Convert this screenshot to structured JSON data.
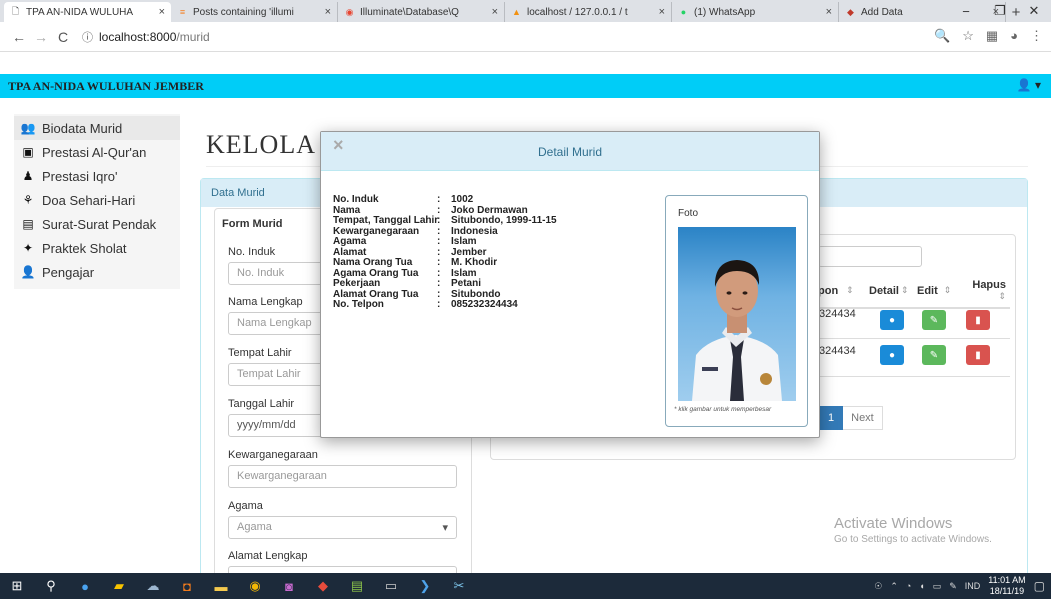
{
  "browser": {
    "tabs": [
      {
        "title": "TPA AN-NIDA WULUHA",
        "icon": "page-icon",
        "active": true
      },
      {
        "title": "Posts containing 'illumi",
        "icon": "stack-icon"
      },
      {
        "title": "Illuminate\\Database\\Q",
        "icon": "laravel-icon"
      },
      {
        "title": "localhost / 127.0.0.1 / t",
        "icon": "phpmyadmin-icon"
      },
      {
        "title": "(1) WhatsApp",
        "icon": "whatsapp-icon"
      },
      {
        "title": "Add Data",
        "icon": "graduation-cap-icon"
      }
    ],
    "url_host": "localhost:8000",
    "url_path": "/murid"
  },
  "app": {
    "brand": "TPA AN-NIDA WULUHAN JEMBER",
    "user_icon": "user-icon",
    "sidebar": [
      {
        "label": "Biodata Murid",
        "icon": "users-icon",
        "active": true
      },
      {
        "label": "Prestasi Al-Qur'an",
        "icon": "book-icon"
      },
      {
        "label": "Prestasi Iqro'",
        "icon": "reader-icon"
      },
      {
        "label": "Doa Sehari-Hari",
        "icon": "pray-icon"
      },
      {
        "label": "Surat-Surat Pendak",
        "icon": "list-icon"
      },
      {
        "label": "Praktek Sholat",
        "icon": "prayer-icon"
      },
      {
        "label": "Pengajar",
        "icon": "user-plus-icon"
      }
    ],
    "page_title": "KELOLA BI",
    "panel_title": "Data Murid",
    "form": {
      "title": "Form Murid",
      "fields": [
        {
          "label": "No. Induk",
          "placeholder": "No. Induk"
        },
        {
          "label": "Nama Lengkap",
          "placeholder": "Nama Lengkap"
        },
        {
          "label": "Tempat Lahir",
          "placeholder": "Tempat Lahir"
        },
        {
          "label": "Tanggal Lahir",
          "placeholder": "yyyy/mm/dd"
        },
        {
          "label": "Kewarganegaraan",
          "placeholder": "Kewarganegaraan"
        },
        {
          "label": "Agama",
          "placeholder": "Agama"
        },
        {
          "label": "Alamat Lengkap",
          "placeholder": ""
        }
      ]
    },
    "table": {
      "headers": {
        "phone": "pon",
        "detail": "Detail",
        "edit": "Edit",
        "hapus": "Hapus"
      },
      "rows": [
        {
          "phone": "324434"
        },
        {
          "phone": "324434"
        }
      ],
      "pager_current": "1",
      "pager_next": "Next"
    }
  },
  "modal": {
    "close": "×",
    "title": "Detail Murid",
    "details": [
      {
        "label": "No. Induk",
        "value": "1002"
      },
      {
        "label": "Nama",
        "value": "Joko Dermawan"
      },
      {
        "label": "Tempat, Tanggal Lahir",
        "value": "Situbondo, 1999-11-15"
      },
      {
        "label": "Kewarganegaraan",
        "value": "Indonesia"
      },
      {
        "label": "Agama",
        "value": "Islam"
      },
      {
        "label": "Alamat",
        "value": "Jember"
      },
      {
        "label": "Nama Orang Tua",
        "value": "M. Khodir"
      },
      {
        "label": "Agama Orang Tua",
        "value": "Islam"
      },
      {
        "label": "Pekerjaan",
        "value": "Petani"
      },
      {
        "label": "Alamat Orang Tua",
        "value": "Situbondo"
      },
      {
        "label": "No. Telpon",
        "value": "085232324434"
      }
    ],
    "foto_label": "Foto",
    "foto_hint": "* klik gambar untuk memperbesar"
  },
  "watermark": {
    "line1": "Activate Windows",
    "line2": "Go to Settings to activate Windows."
  },
  "taskbar": {
    "lang": "IND",
    "time": "11:01 AM",
    "date": "18/11/19"
  },
  "colors": {
    "nav_bg": "#00cdf7",
    "panel_head": "#d9edf7",
    "detail_btn": "#1a8bd8",
    "edit_btn": "#5cb85c",
    "delete_btn": "#d9534f"
  }
}
